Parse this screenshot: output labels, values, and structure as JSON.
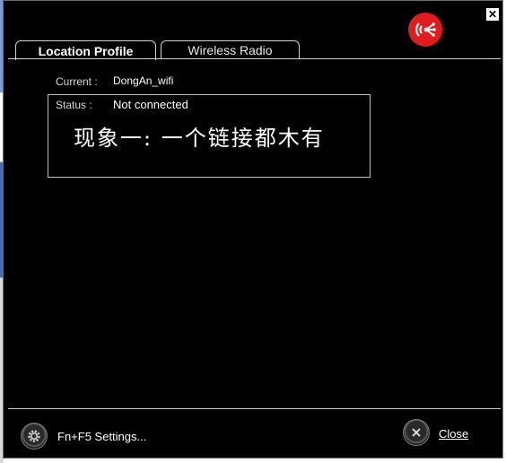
{
  "window": {
    "close_glyph": "✕",
    "logo_icon": "wireless-logo-icon",
    "brand_color": "#e21c1c"
  },
  "tabs": [
    {
      "label_prefix": "Location Profile",
      "active": true
    },
    {
      "label": "Wireless Radio",
      "active": false
    }
  ],
  "profile": {
    "current_label": "Current :",
    "current_value": "DongAn_wifi",
    "status_label": "Status :",
    "status_value": "Not connected"
  },
  "overlay_note": "现象一: 一个链接都木有",
  "footer": {
    "settings_label": "Fn+F5 Settings...",
    "settings_icon": "gear-icon",
    "close_label": "Close",
    "close_icon": "close-icon"
  }
}
